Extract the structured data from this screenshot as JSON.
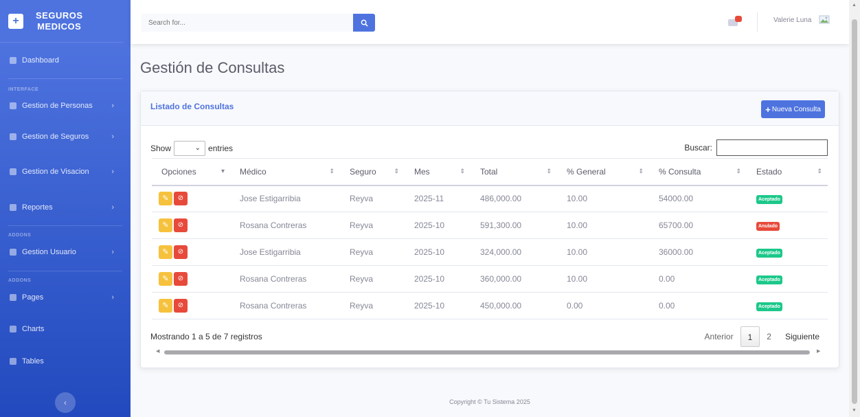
{
  "brand": {
    "line1": "SEGUROS",
    "line2": "MEDICOS"
  },
  "sidebar": {
    "dashboard": "Dashboard",
    "heading_interface": "INTERFACE",
    "heading_addons1": "ADDONS",
    "heading_addons2": "ADDONS",
    "items": [
      {
        "label": "Gestion de Personas"
      },
      {
        "label": "Gestion de Seguros"
      },
      {
        "label": "Gestion de Visacion"
      },
      {
        "label": "Reportes"
      },
      {
        "label": "Gestion Usuario"
      },
      {
        "label": "Pages"
      },
      {
        "label": "Charts"
      },
      {
        "label": "Tables"
      }
    ]
  },
  "topbar": {
    "search_placeholder": "Search for...",
    "user_name": "Valerie Luna"
  },
  "page": {
    "title": "Gestión de Consultas"
  },
  "card": {
    "title": "Listado de Consultas",
    "new_button": "Nueva Consulta"
  },
  "controls": {
    "show_label": "Show",
    "entries_label": "entries",
    "search_label": "Buscar:"
  },
  "table": {
    "headers": [
      "Opciones",
      "Médico",
      "Seguro",
      "Mes",
      "Total",
      "% General",
      "% Consulta",
      "Estado"
    ],
    "rows": [
      [
        "Jose Estigarribia",
        "Reyva",
        "2025-11",
        "486,000.00",
        "10.00",
        "54000.00",
        "Aceptado"
      ],
      [
        "Rosana Contreras",
        "Reyva",
        "2025-10",
        "591,300.00",
        "10.00",
        "65700.00",
        "Anulado"
      ],
      [
        "Jose Estigarribia",
        "Reyva",
        "2025-10",
        "324,000.00",
        "10.00",
        "36000.00",
        "Aceptado"
      ],
      [
        "Rosana Contreras",
        "Reyva",
        "2025-10",
        "360,000.00",
        "10.00",
        "0.00",
        "Aceptado"
      ],
      [
        "Rosana Contreras",
        "Reyva",
        "2025-10",
        "450,000.00",
        "0.00",
        "0.00",
        "Aceptado"
      ]
    ]
  },
  "footer_info": "Mostrando 1 a 5 de 7 registros",
  "pagination": {
    "prev": "Anterior",
    "pages": [
      "1",
      "2"
    ],
    "next": "Siguiente"
  },
  "copyright": "Copyright © Tu Sistema 2025",
  "colors": {
    "primary": "#4e73df",
    "success": "#1cc88a",
    "danger": "#e74a3b",
    "warning": "#f6c23e"
  }
}
